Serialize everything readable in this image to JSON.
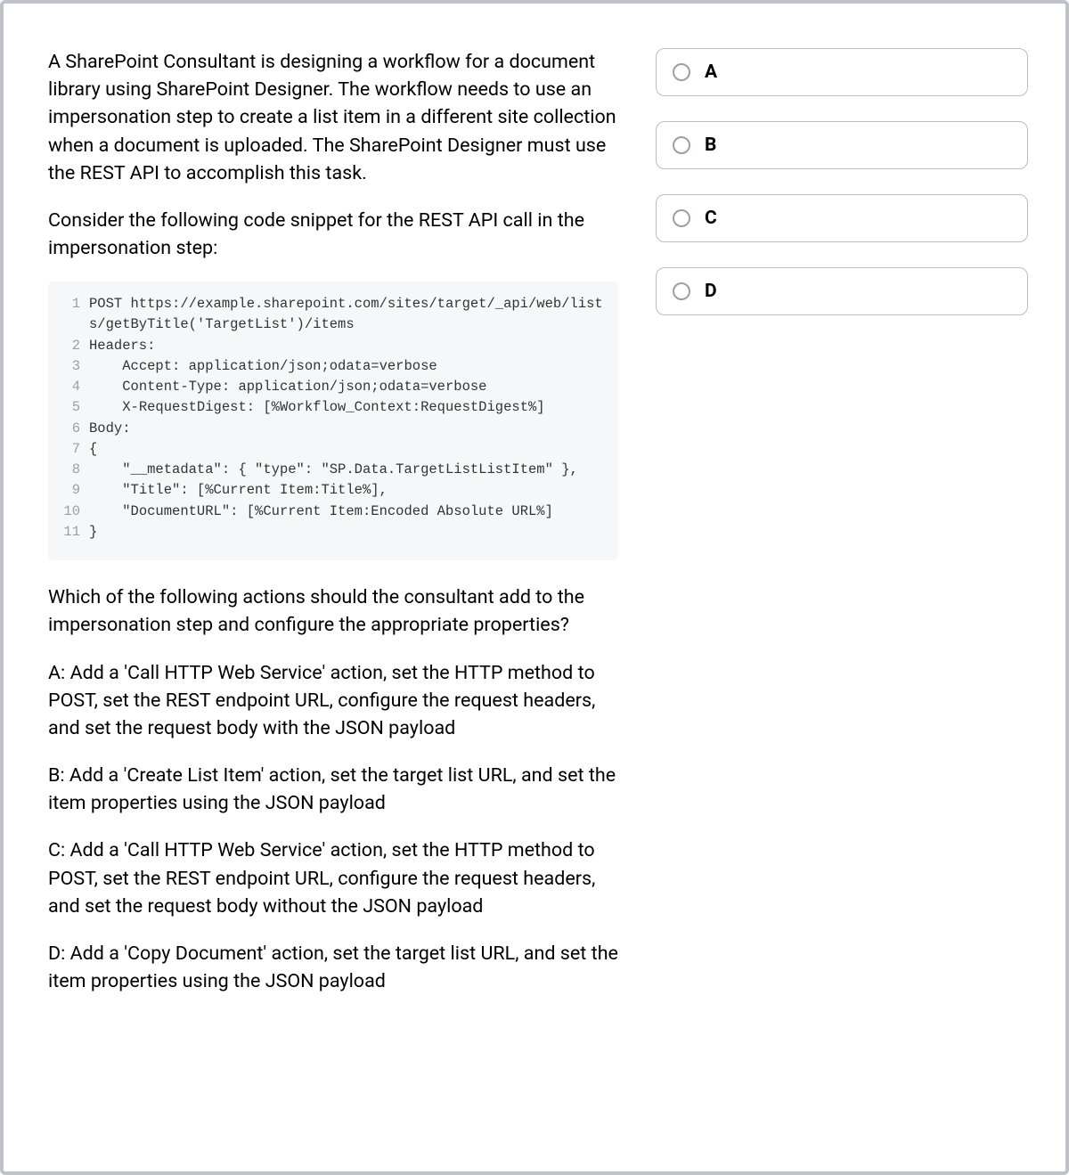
{
  "question": {
    "intro1": "A SharePoint Consultant is designing a workflow for a document library using SharePoint Designer. The workflow needs to use an impersonation step to create a list item in a different site collection when a document is uploaded. The SharePoint Designer must use the REST API to accomplish this task.",
    "intro2": "Consider the following code snippet for the REST API call in the impersonation step:",
    "prompt": "Which of the following actions should the consultant add to the impersonation step and configure the appropriate properties?",
    "optA": "A: Add a 'Call HTTP Web Service' action, set the HTTP method to POST, set the REST endpoint URL, configure the request headers, and set the request body with the JSON payload",
    "optB": "B: Add a 'Create List Item' action, set the target list URL, and set the item properties using the JSON payload",
    "optC": "C: Add a 'Call HTTP Web Service' action, set the HTTP method to POST, set the REST endpoint URL, configure the request headers, and set the request body without the JSON payload",
    "optD": "D: Add a 'Copy Document' action, set the target list URL, and set the item properties using the JSON payload"
  },
  "code": {
    "l1": "POST https://example.sharepoint.com/sites/target/_api/web/lists/getByTitle('TargetList')/items",
    "l2": "Headers:",
    "l3": "    Accept: application/json;odata=verbose",
    "l4": "    Content-Type: application/json;odata=verbose",
    "l5": "    X-RequestDigest: [%Workflow_Context:RequestDigest%]",
    "l6": "Body:",
    "l7": "{",
    "l8": "    \"__metadata\": { \"type\": \"SP.Data.TargetListListItem\" },",
    "l9": "    \"Title\": [%Current Item:Title%],",
    "l10": "    \"DocumentURL\": [%Current Item:Encoded Absolute URL%]",
    "l11": "}"
  },
  "gutters": {
    "n1": "1",
    "n2": "2",
    "n3": "3",
    "n4": "4",
    "n5": "5",
    "n6": "6",
    "n7": "7",
    "n8": "8",
    "n9": "9",
    "n10": "10",
    "n11": "11"
  },
  "answers": {
    "a": "A",
    "b": "B",
    "c": "C",
    "d": "D"
  }
}
